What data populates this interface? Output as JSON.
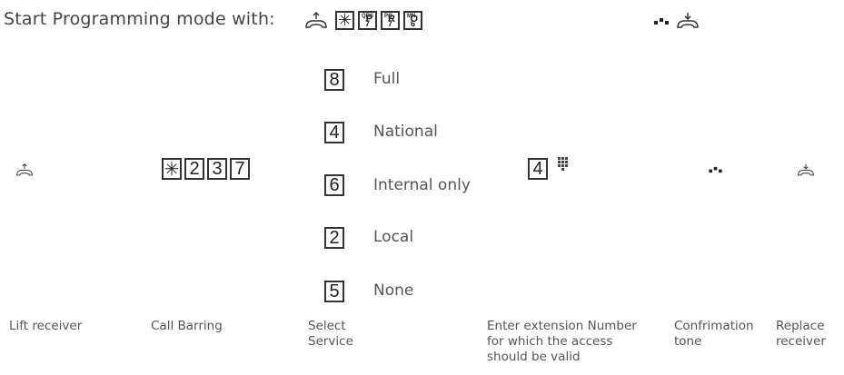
{
  "header": {
    "text": "Start Programming mode with:",
    "keys": [
      {
        "symbol": "✳"
      },
      {
        "letter": "P",
        "sup": "QRS",
        "digit": "7"
      },
      {
        "letter": "R",
        "sup": "PQ",
        "digit": "7"
      },
      {
        "letter": "O",
        "sup": "MN",
        "digit": "6"
      }
    ]
  },
  "sequence": {
    "star_key": "✳",
    "digits": [
      "2",
      "3",
      "7"
    ]
  },
  "options": [
    {
      "key": "8",
      "label": "Full"
    },
    {
      "key": "4",
      "label": "National"
    },
    {
      "key": "6",
      "label": "Internal only"
    },
    {
      "key": "2",
      "label": "Local"
    },
    {
      "key": "5",
      "label": "None"
    }
  ],
  "extension_key": "4",
  "captions": {
    "lift": "Lift receiver",
    "barring": "Call Barring",
    "select": "Select Service",
    "enter": "Enter extension Number for which the access should be valid",
    "confirm": "Confrimation tone",
    "replace": "Replace receiver"
  },
  "icons": [
    "lift-receiver-icon",
    "keypad-icon",
    "confirmation-tone-icon",
    "replace-receiver-icon"
  ]
}
